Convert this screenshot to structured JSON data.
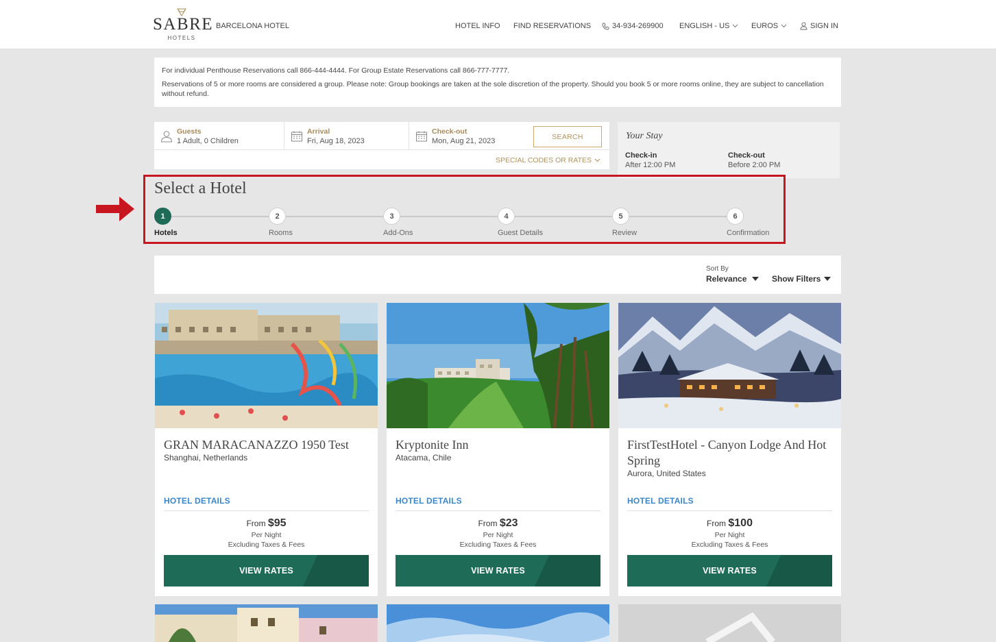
{
  "header": {
    "logo_word": "SABRE",
    "logo_sub": "HOTELS",
    "brand_name": "BARCELONA HOTEL",
    "nav": {
      "hotel_info": "HOTEL INFO",
      "find_reservations": "FIND RESERVATIONS",
      "phone": "34-934-269900",
      "language": "ENGLISH - US",
      "currency": "EUROS",
      "sign_in": "SIGN IN"
    }
  },
  "notice": {
    "line1": "For individual Penthouse Reservations call 866-444-4444. For Group Estate Reservations call 866-777-7777.",
    "line2": "Reservations of 5 or more rooms are considered a group. Please note: Group bookings are taken at the sole discretion of the property. Should you book 5 or more rooms online, they are subject to cancellation without refund."
  },
  "booking": {
    "guests_label": "Guests",
    "guests_value": "1 Adult, 0 Children",
    "arrival_label": "Arrival",
    "arrival_value": "Fri, Aug 18, 2023",
    "checkout_label": "Check-out",
    "checkout_value": "Mon, Aug 21, 2023",
    "search_label": "SEARCH",
    "special_codes": "SPECIAL CODES OR RATES"
  },
  "stay": {
    "title": "Your Stay",
    "checkin_label": "Check-in",
    "checkin_time": "After 12:00 PM",
    "checkout_label": "Check-out",
    "checkout_time": "Before 2:00 PM"
  },
  "section_title": "Select a Hotel",
  "steps": [
    {
      "num": "1",
      "label": "Hotels"
    },
    {
      "num": "2",
      "label": "Rooms"
    },
    {
      "num": "3",
      "label": "Add-Ons"
    },
    {
      "num": "4",
      "label": "Guest Details"
    },
    {
      "num": "5",
      "label": "Review"
    },
    {
      "num": "6",
      "label": "Confirmation"
    }
  ],
  "sort": {
    "label": "Sort By",
    "value": "Relevance",
    "filters": "Show Filters"
  },
  "hotels": [
    {
      "name": "GRAN MARACANAZZO 1950 Test",
      "location": "Shanghai, Netherlands",
      "details": "HOTEL DETAILS",
      "from": "From",
      "price": "$95",
      "per_night": "Per Night",
      "tax": "Excluding Taxes & Fees",
      "cta": "VIEW RATES"
    },
    {
      "name": "Kryptonite Inn",
      "location": "Atacama, Chile",
      "details": "HOTEL DETAILS",
      "from": "From",
      "price": "$23",
      "per_night": "Per Night",
      "tax": "Excluding Taxes & Fees",
      "cta": "VIEW RATES"
    },
    {
      "name": "FirstTestHotel - Canyon Lodge And Hot Spring",
      "location": "Aurora, United States",
      "details": "HOTEL DETAILS",
      "from": "From",
      "price": "$100",
      "per_night": "Per Night",
      "tax": "Excluding Taxes & Fees",
      "cta": "VIEW RATES"
    }
  ],
  "colors": {
    "primary_green": "#1e6b57",
    "gold": "#b09260",
    "highlight_red": "#c7161f",
    "link_blue": "#3a86c8"
  }
}
